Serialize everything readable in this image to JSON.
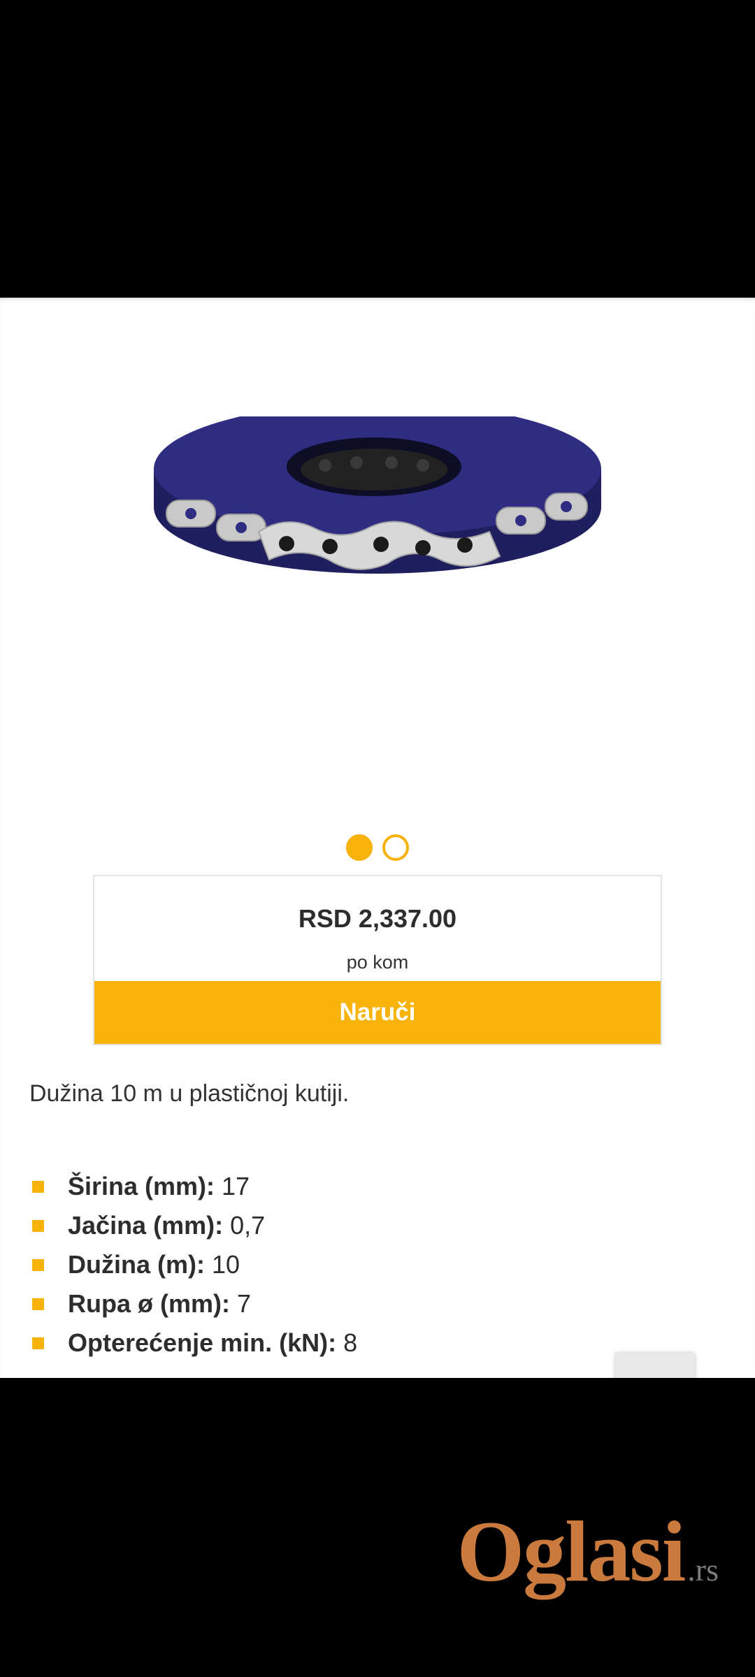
{
  "gallery": {
    "image_icon": "steel-band-roll-image",
    "dots": [
      true,
      false
    ]
  },
  "price_box": {
    "price": "RSD 2,337.00",
    "unit": "po kom",
    "order_label": "Naruči"
  },
  "description": "Dužina 10 m u plastičnoj kutiji.",
  "specs": [
    {
      "label": "Širina (mm):",
      "value": "17"
    },
    {
      "label": "Jačina (mm):",
      "value": "0,7"
    },
    {
      "label": "Dužina (m):",
      "value": "10"
    },
    {
      "label": "Rupa ø (mm):",
      "value": "7"
    },
    {
      "label": "Opterećenje min. (kN):",
      "value": "8"
    }
  ],
  "watermark": {
    "main": "Oglasi",
    "tld": ".rs"
  },
  "colors": {
    "accent": "#f7b30a",
    "text": "#2d2d2d",
    "reel": "#2b2a78",
    "watermark": "#c97a3c"
  }
}
